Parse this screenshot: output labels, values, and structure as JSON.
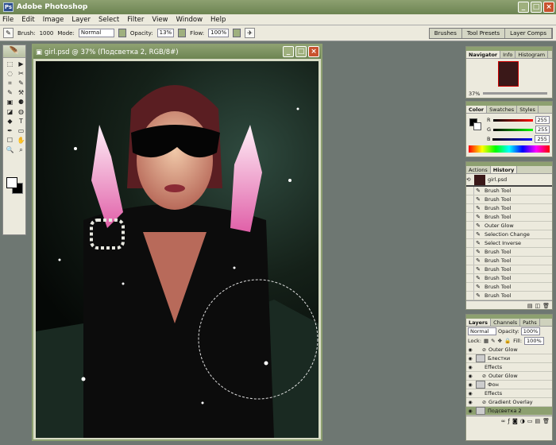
{
  "app": {
    "title": "Adobe Photoshop",
    "logo": "Ps"
  },
  "window_controls": {
    "minimize": "_",
    "maximize": "□",
    "close": "×"
  },
  "menu": [
    "File",
    "Edit",
    "Image",
    "Layer",
    "Select",
    "Filter",
    "View",
    "Window",
    "Help"
  ],
  "options": {
    "brush_label": "Brush:",
    "brush_size": "1000",
    "mode_label": "Mode:",
    "mode_value": "Normal",
    "opacity_label": "Opacity:",
    "opacity_value": "13%",
    "flow_label": "Flow:",
    "flow_value": "100%"
  },
  "palette_well": [
    "Brushes",
    "Tool Presets",
    "Layer Comps"
  ],
  "toolbox_icons": [
    "⬚",
    "▶",
    "◌",
    "✂",
    "⌗",
    "✎",
    "✎",
    "⚒",
    "▣",
    "⚈",
    "◪",
    "◍",
    "◆",
    "T",
    "✒",
    "▭",
    "☐",
    "✋",
    "🔍",
    "⌕"
  ],
  "document": {
    "title": "girl.psd @ 37% (Подсветка 2, RGB/8#)"
  },
  "navigator": {
    "tabs": [
      "Navigator",
      "Info",
      "Histogram"
    ],
    "zoom": "37%"
  },
  "color": {
    "tabs": [
      "Color",
      "Swatches",
      "Styles"
    ],
    "channels": [
      {
        "name": "R",
        "value": "255"
      },
      {
        "name": "G",
        "value": "255"
      },
      {
        "name": "B",
        "value": "255"
      }
    ]
  },
  "history": {
    "tabs": [
      "Actions",
      "History"
    ],
    "snapshot": "girl.psd",
    "items": [
      "Brush Tool",
      "Brush Tool",
      "Brush Tool",
      "Brush Tool",
      "Outer Glow",
      "Selection Change",
      "Select Inverse",
      "Brush Tool",
      "Brush Tool",
      "Brush Tool",
      "Brush Tool",
      "Brush Tool",
      "Brush Tool"
    ]
  },
  "layers": {
    "tabs": [
      "Layers",
      "Channels",
      "Paths"
    ],
    "blend_mode": "Normal",
    "opacity_label": "Opacity:",
    "opacity_value": "100%",
    "lock_label": "Lock:",
    "fill_label": "Fill:",
    "fill_value": "100%",
    "rows": [
      {
        "label": "Outer Glow",
        "kind": "effect"
      },
      {
        "label": "Блестки",
        "kind": "layer"
      },
      {
        "label": "Effects",
        "kind": "effects"
      },
      {
        "label": "Outer Glow",
        "kind": "effect"
      },
      {
        "label": "Фон",
        "kind": "layer"
      },
      {
        "label": "Effects",
        "kind": "effects"
      },
      {
        "label": "Gradient Overlay",
        "kind": "effect"
      },
      {
        "label": "Подсветка 2",
        "kind": "layer-active"
      }
    ]
  },
  "colors": {
    "accent": "#8da070",
    "panel_bg": "#eceadd",
    "workspace": "#6e7772"
  }
}
